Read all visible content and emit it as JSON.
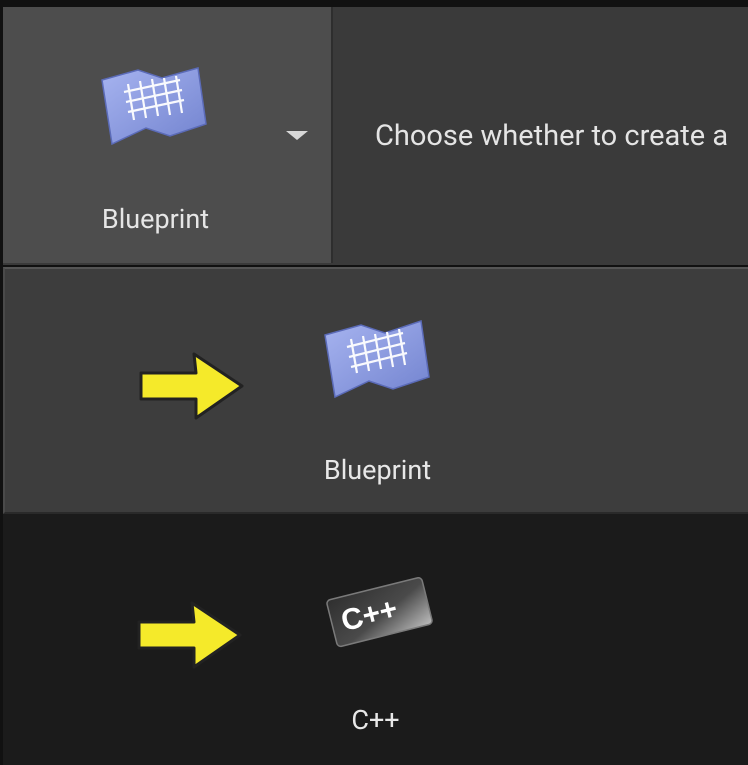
{
  "header": {
    "template_selector": {
      "label": "Blueprint",
      "icon": "blueprint-icon",
      "dropdown_icon": "chevron-down-icon"
    },
    "description": "Choose whether to create a"
  },
  "options": [
    {
      "label": "Blueprint",
      "icon": "blueprint-icon",
      "selected": true
    },
    {
      "label": "C++",
      "icon": "cpp-icon",
      "icon_text": "C++",
      "selected": false
    }
  ],
  "annotations": {
    "arrow_color": "#f5ea2a",
    "arrow_icon": "arrow-right-icon"
  },
  "colors": {
    "blueprint_icon": "#8f9fe0",
    "header_bg": "#3a3a3a",
    "selected_option_bg": "#3d3d3d",
    "unselected_option_bg": "#1b1b1b"
  }
}
